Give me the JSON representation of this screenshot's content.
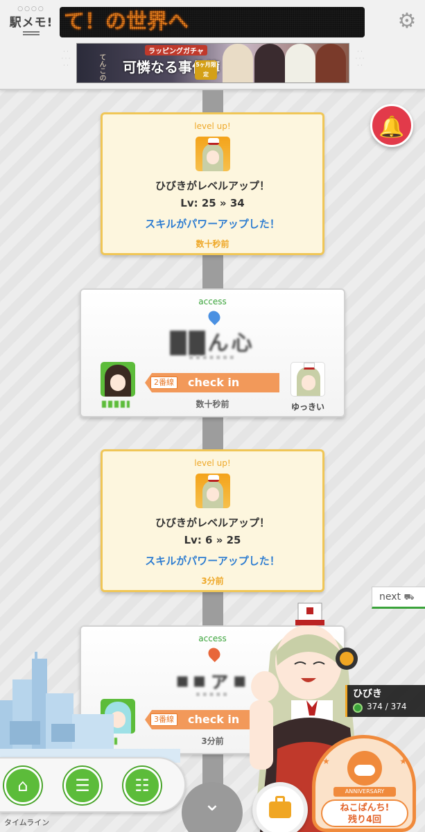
{
  "header": {
    "logo_text": "駅メモ!",
    "logo_dots": "○○○○",
    "marquee_text": "て！の世界へ",
    "banner": {
      "tag": "ラッピングガチャ",
      "small_text": "てんこの",
      "title": "可憐なる事件簿",
      "badge": "5ヶ月限定"
    }
  },
  "timeline": {
    "cards": [
      {
        "type": "level up!",
        "message": "ひびきがレベルアップ！",
        "level": "Lv: 25 » 34",
        "skill": "スキルがパワーアップした！",
        "time": "数十秒前"
      },
      {
        "type": "access",
        "station": "██ん心",
        "reading": "▪▪▪▪▪▪▪",
        "line": "2番線",
        "action": "check in",
        "time": "数十秒前",
        "partner_name": "ゆっきい",
        "pin_color": "#4a90e2",
        "avatar_hair": "#3b2a22"
      },
      {
        "type": "level up!",
        "message": "ひびきがレベルアップ！",
        "level": "Lv: 6 » 25",
        "skill": "スキルがパワーアップした！",
        "time": "3分前"
      },
      {
        "type": "access",
        "station": "▪▪ァ▪",
        "reading": "▪▪▪▪▪",
        "line": "3番線",
        "action": "check in",
        "time": "3分前",
        "pin_color": "#e8663a",
        "avatar_hair": "#9ee0e6"
      }
    ]
  },
  "next_label": "next",
  "status": {
    "name": "ひびき",
    "hp": "374 / 374"
  },
  "nav": {
    "label": "タイムライン",
    "items": [
      "home-icon",
      "timeline-icon",
      "train-list-icon"
    ]
  },
  "anniversary": {
    "ribbon": "ANNIVERSARY",
    "line1": "ねこぱんち!",
    "line2": "残り4回"
  },
  "icons": {
    "settings": "gear-icon",
    "notification": "bell-icon",
    "scroll": "chevron-down-icon",
    "items": "briefcase-icon"
  },
  "colors": {
    "accent_green": "#5cbc3a",
    "levelup_border": "#f0c656",
    "checkin_orange": "#f2995a",
    "bell_red": "#e23a4a",
    "skill_blue": "#2e7dd1"
  }
}
